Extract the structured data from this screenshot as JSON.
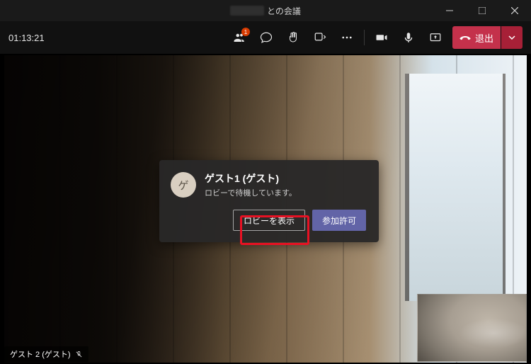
{
  "titlebar": {
    "title_suffix": "との会議"
  },
  "toolbar": {
    "timer": "01:13:21",
    "people_badge": "1",
    "leave_label": "退出"
  },
  "notification": {
    "avatar_initial": "ゲ",
    "name": "ゲスト1 (ゲスト)",
    "subtitle": "ロビーで待機しています。",
    "view_lobby_label": "ロビーを表示",
    "admit_label": "参加許可"
  },
  "participant": {
    "label": "ゲスト 2 (ゲスト)"
  }
}
